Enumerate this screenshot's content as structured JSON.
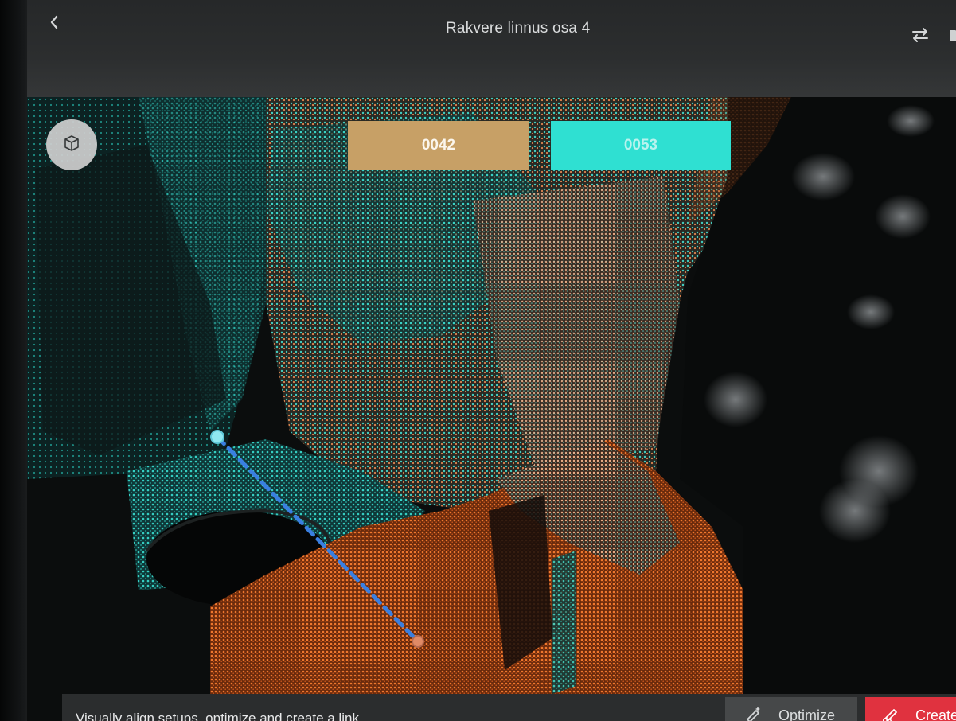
{
  "header": {
    "title": "Rakvere linnus osa 4",
    "back_icon": "chevron-left-icon",
    "swap_icon": "swap-arrows-icon"
  },
  "viewport": {
    "view_cube_icon": "cube-icon",
    "setups": [
      {
        "label": "0042",
        "color": "#c7a066"
      },
      {
        "label": "0053",
        "color": "#2fe0d2"
      }
    ],
    "link_line_color": "#3a7fe0"
  },
  "bottom_bar": {
    "instruction": "Visually align setups, optimize and create a link",
    "optimize_label": "Optimize",
    "create_label": "Create",
    "optimize_color": "#464849",
    "create_color": "#e0323f"
  }
}
